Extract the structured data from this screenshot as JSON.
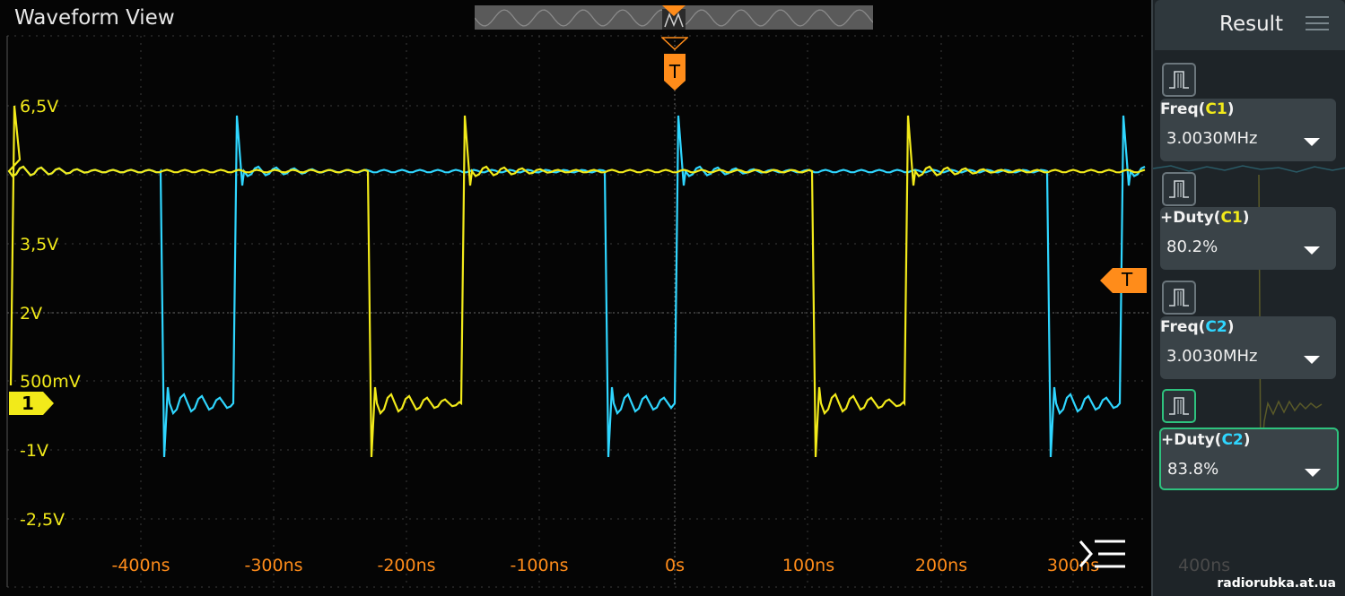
{
  "window": {
    "title": "Waveform View"
  },
  "colors": {
    "ch1": "#f2ea1a",
    "ch2": "#2fd6ff",
    "trigger": "#ff8c1a",
    "grid": "#3a3a3a",
    "selected": "#2ec27e"
  },
  "axes": {
    "voltage_labels": [
      "6,5V",
      "3,5V",
      "2V",
      "500mV",
      "-1V",
      "-2,5V"
    ],
    "time_labels": [
      "-400ns",
      "-300ns",
      "-200ns",
      "-100ns",
      "0s",
      "100ns",
      "200ns",
      "300ns"
    ],
    "time_label_offscreen": "400ns"
  },
  "markers": {
    "channel1": "1",
    "trigger_top": "T",
    "trigger_level": "T"
  },
  "result_panel": {
    "title": "Result",
    "measurements": [
      {
        "name": "Freq",
        "channel": "C1",
        "value": "3.0030MHz",
        "selected": false
      },
      {
        "name": "+Duty",
        "channel": "C1",
        "value": "80.2%",
        "selected": false
      },
      {
        "name": "Freq",
        "channel": "C2",
        "value": "3.0030MHz",
        "selected": false
      },
      {
        "name": "+Duty",
        "channel": "C2",
        "value": "83.8%",
        "selected": true
      }
    ]
  },
  "icons": {
    "header_menu": "hamburger-icon",
    "measurement": "waveform-measure-icon",
    "menu_button": "menu-collapse-icon"
  },
  "watermark": "radiorubka.at.ua"
}
